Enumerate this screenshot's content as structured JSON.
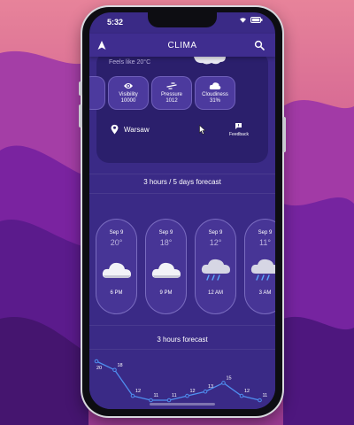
{
  "status_bar": {
    "time": "5:32"
  },
  "app": {
    "title": "CLIMA"
  },
  "current": {
    "feels_like": "Feels like 20°C"
  },
  "stats": [
    {
      "label": "",
      "value": "",
      "icon": "partial-card"
    },
    {
      "label": "Visibility",
      "value": "10000",
      "icon": "eye-icon"
    },
    {
      "label": "Pressure",
      "value": "1012",
      "icon": "wind-icon"
    },
    {
      "label": "Cloudiness",
      "value": "31%",
      "icon": "cloud-icon"
    }
  ],
  "location": {
    "name": "Warsaw"
  },
  "feedback": {
    "label": "Feedback"
  },
  "sections": {
    "days_forecast": "3 hours / 5 days forecast",
    "hours_forecast": "3 hours forecast"
  },
  "forecast": [
    {
      "date": "Sep 9",
      "temp": "20°",
      "time": "6 PM",
      "icon": "cloud-icon"
    },
    {
      "date": "Sep 9",
      "temp": "18°",
      "time": "9 PM",
      "icon": "cloud-icon"
    },
    {
      "date": "Sep 9",
      "temp": "12°",
      "time": "12 AM",
      "icon": "rain-cloud-icon"
    },
    {
      "date": "Sep 9",
      "temp": "11°",
      "time": "3 AM",
      "icon": "rain-cloud-icon"
    }
  ],
  "chart_data": {
    "type": "line",
    "values": [
      20,
      18,
      12,
      11,
      11,
      12,
      13,
      15,
      12,
      11
    ],
    "value_labels": [
      "20",
      "18",
      "12",
      "11",
      "11",
      "12",
      "13",
      "15",
      "12",
      "11"
    ],
    "color": "#4f8ff0"
  },
  "colors": {
    "background": "#3a2a86",
    "card": "#2b1f6c",
    "accent_line": "#4f8ff0"
  }
}
